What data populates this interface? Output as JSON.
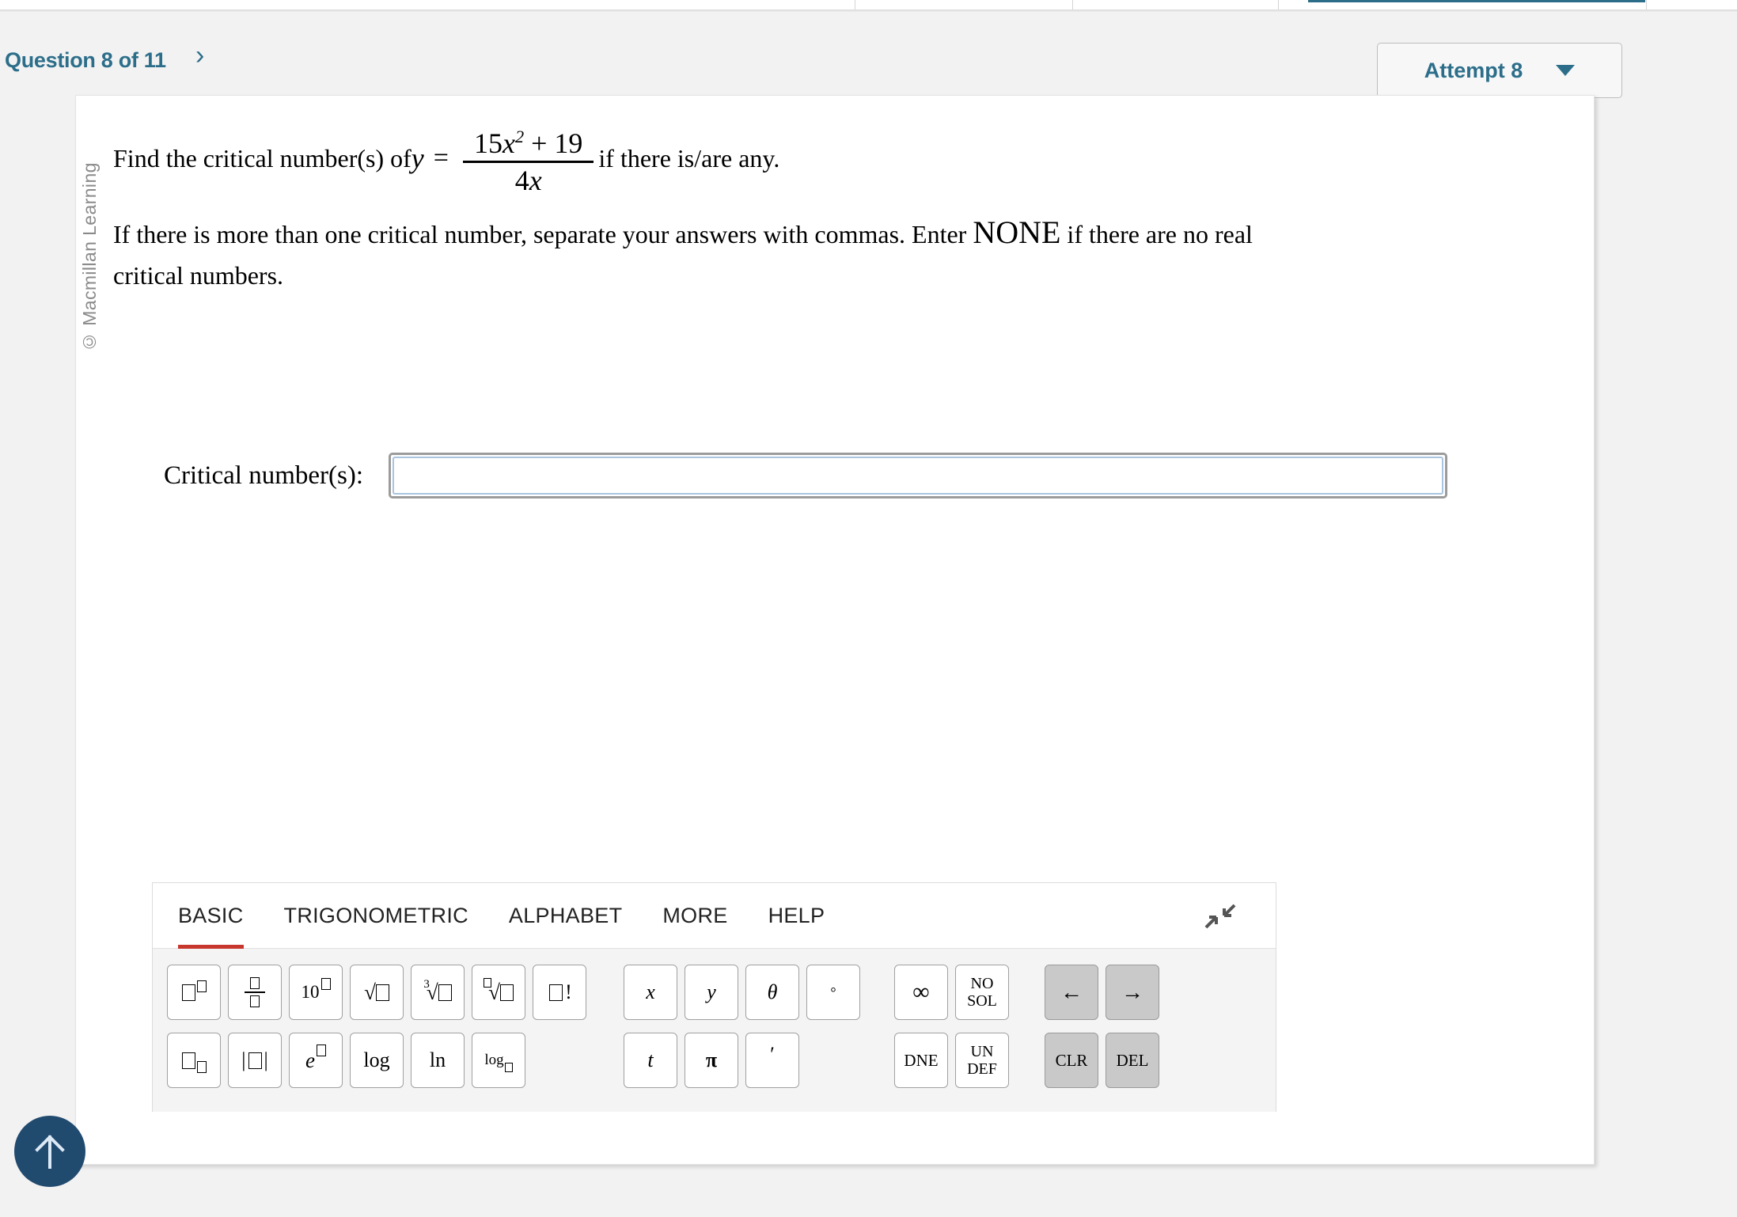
{
  "top_nav": {
    "divider_positions": [
      1080,
      1355,
      1615,
      2080
    ],
    "active_tab_underline_color": "#2c6e8a"
  },
  "header": {
    "question_counter": "Question 8 of 11",
    "next_chevron": "›",
    "attempt_label": "Attempt 8",
    "accent_color": "#2c6e8a"
  },
  "copyright": "© Macmillan Learning",
  "problem": {
    "prefix": "Find the critical number(s) of ",
    "variable": "y",
    "equals": "=",
    "numerator_coefficient": "15",
    "numerator_variable": "x",
    "numerator_exponent": "2",
    "numerator_plus": "+ 19",
    "numerator_full": "15x² + 19",
    "denominator": "4x",
    "suffix": "if there is/are any.",
    "line2_part1": "If there is more than one critical number, separate your answers with commas. Enter ",
    "line2_none": "NONE",
    "line2_part2": " if there are no real",
    "line3": "critical numbers."
  },
  "answer": {
    "label": "Critical number(s):",
    "value": "",
    "placeholder": ""
  },
  "keypad": {
    "tabs": [
      {
        "label": "BASIC",
        "active": true
      },
      {
        "label": "TRIGONOMETRIC",
        "active": false
      },
      {
        "label": "ALPHABET",
        "active": false
      },
      {
        "label": "MORE",
        "active": false
      },
      {
        "label": "HELP",
        "active": false
      }
    ],
    "active_tab_color": "#c8372d",
    "collapse_icon": "collapse-arrows-icon",
    "group_math": {
      "row1": [
        {
          "name": "power-key",
          "glyph": "□^□"
        },
        {
          "name": "fraction-key",
          "glyph": "□/□"
        },
        {
          "name": "power-of-ten-key",
          "glyph": "10^□"
        },
        {
          "name": "square-root-key",
          "glyph": "√□"
        },
        {
          "name": "cube-root-key",
          "glyph": "∛□"
        },
        {
          "name": "nth-root-key",
          "glyph": "□√□"
        },
        {
          "name": "factorial-key",
          "glyph": "□!"
        }
      ],
      "row2": [
        {
          "name": "subscript-key",
          "glyph": "□_□"
        },
        {
          "name": "absolute-value-key",
          "glyph": "|□|"
        },
        {
          "name": "exponential-e-key",
          "glyph": "e^□"
        },
        {
          "name": "log-key",
          "glyph": "log"
        },
        {
          "name": "natural-log-key",
          "glyph": "ln"
        },
        {
          "name": "log-base-key",
          "glyph": "log_□"
        }
      ]
    },
    "group_variables": {
      "row1": [
        {
          "name": "variable-x-key",
          "glyph": "x"
        },
        {
          "name": "variable-y-key",
          "glyph": "y"
        },
        {
          "name": "theta-key",
          "glyph": "θ"
        },
        {
          "name": "degree-key",
          "glyph": "°"
        }
      ],
      "row2": [
        {
          "name": "variable-t-key",
          "glyph": "t"
        },
        {
          "name": "pi-key",
          "glyph": "π"
        },
        {
          "name": "prime-key",
          "glyph": "′"
        }
      ]
    },
    "group_special": {
      "row1": [
        {
          "name": "infinity-key",
          "glyph": "∞"
        },
        {
          "name": "no-solution-key",
          "line1": "NO",
          "line2": "SOL"
        }
      ],
      "row2": [
        {
          "name": "dne-key",
          "glyph": "DNE"
        },
        {
          "name": "undefined-key",
          "line1": "UN",
          "line2": "DEF"
        }
      ]
    },
    "group_controls": {
      "row1": [
        {
          "name": "cursor-left-key",
          "glyph": "←"
        },
        {
          "name": "cursor-right-key",
          "glyph": "→"
        }
      ],
      "row2": [
        {
          "name": "clear-key",
          "glyph": "CLR"
        },
        {
          "name": "delete-key",
          "glyph": "DEL"
        }
      ]
    }
  },
  "scroll_top": {
    "icon": "arrow-up-icon",
    "background_color": "#214a6f"
  }
}
